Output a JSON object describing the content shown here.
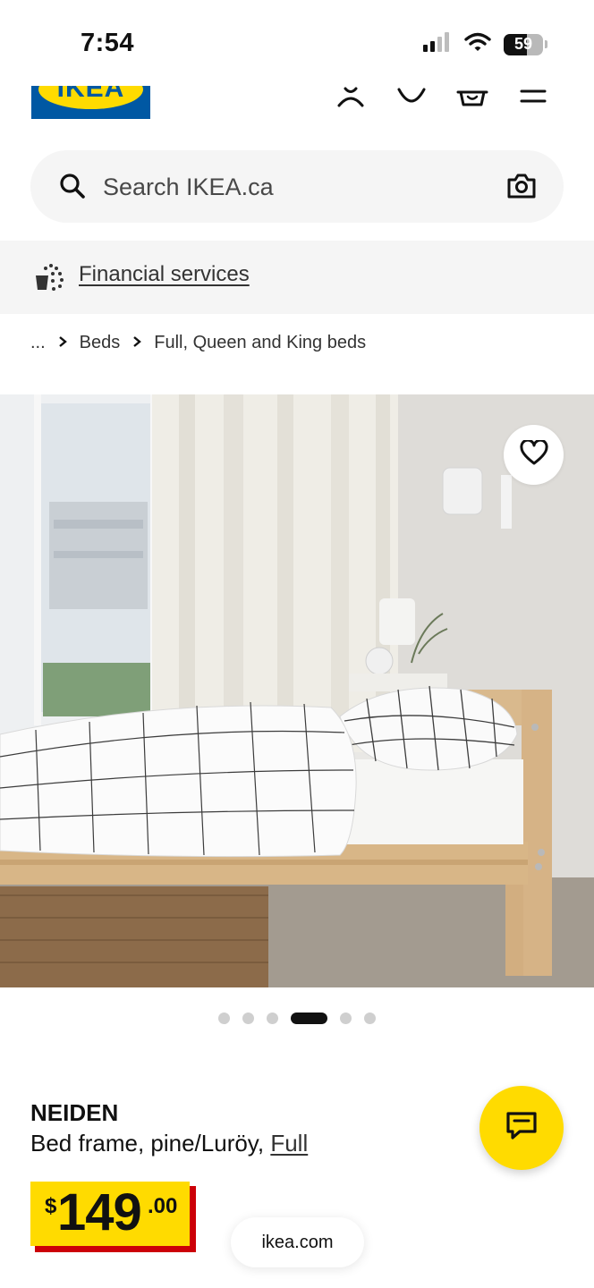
{
  "status": {
    "time": "7:54",
    "battery": "59",
    "battery_level": 0.59,
    "icons": [
      "cellular-signal-icon",
      "wifi-icon",
      "battery-icon"
    ]
  },
  "header": {
    "logo_text": "IKEA",
    "icons": [
      "profile-icon",
      "heart-icon",
      "basket-icon",
      "menu-icon"
    ]
  },
  "search": {
    "placeholder": "Search IKEA.ca",
    "icons": [
      "search-icon",
      "camera-icon"
    ]
  },
  "financial": {
    "label": "Financial services"
  },
  "breadcrumb": {
    "ellipsis": "...",
    "items": [
      "Beds",
      "Full, Queen and King beds"
    ]
  },
  "carousel": {
    "total": 6,
    "active_index": 3
  },
  "product": {
    "name": "NEIDEN",
    "description": "Bed frame, pine/Luröy, ",
    "size_link": "Full",
    "price_currency": "$",
    "price_integer": "149",
    "price_decimal": ".00"
  },
  "browser": {
    "url": "ikea.com"
  },
  "colors": {
    "ikea_blue": "#0058a3",
    "ikea_yellow": "#ffdb00",
    "price_shadow_red": "#cc0008"
  }
}
